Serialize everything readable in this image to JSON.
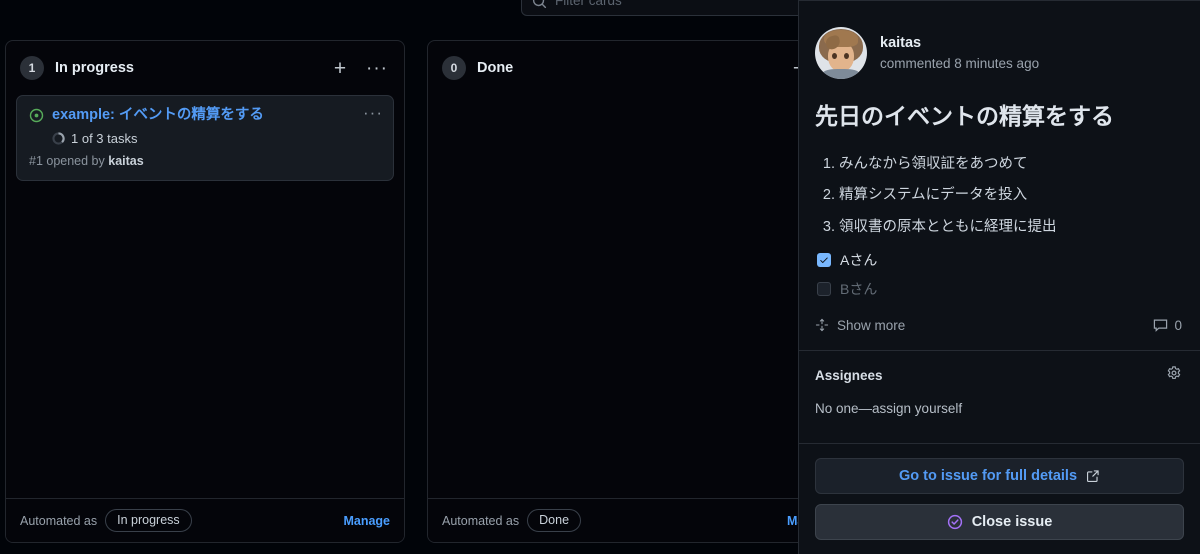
{
  "search": {
    "placeholder": "Filter cards",
    "icon": "search-icon"
  },
  "board": {
    "columns": [
      {
        "count": "1",
        "title": "In progress",
        "add_icon": "plus-icon",
        "menu_icon": "kebab-menu-icon",
        "automation_label": "Automated as",
        "automation_value": "In progress",
        "manage_label": "Manage",
        "cards": [
          {
            "status_icon": "issue-open-icon",
            "title": "example: イベントの精算をする",
            "progress_icon": "task-progress-icon",
            "tasks": "1 of 3 tasks",
            "meta_prefix": "#1 opened by",
            "meta_author": "kaitas",
            "menu_icon": "kebab-menu-icon"
          }
        ]
      },
      {
        "count": "0",
        "title": "Done",
        "add_icon": "plus-icon",
        "automation_label": "Automated as",
        "automation_value": "Done",
        "manage_label": "Man",
        "cards": []
      }
    ]
  },
  "panel": {
    "author": {
      "name": "kaitas",
      "meta": "commented 8 minutes ago",
      "avatar_icon": "user-avatar"
    },
    "issue_title": "先日のイベントの精算をする",
    "steps": [
      "みんなから領収証をあつめて",
      "精算システムにデータを投入",
      "領収書の原本とともに経理に提出"
    ],
    "tasks": [
      {
        "label": "Aさん",
        "checked": true
      },
      {
        "label": "Bさん",
        "checked": false
      }
    ],
    "show_more": {
      "label": "Show more",
      "icon": "expand-arrows-icon"
    },
    "comments": {
      "count": "0",
      "icon": "comment-icon"
    },
    "assignees": {
      "title": "Assignees",
      "value": "No one—assign yourself",
      "gear_icon": "gear-icon"
    },
    "actions": {
      "go_label": "Go to issue for full details",
      "go_icon": "external-link-icon",
      "close_label": "Close issue",
      "close_icon": "issue-closed-icon"
    }
  },
  "colors": {
    "accent_link": "#539bf5",
    "issue_open": "#57ab5a",
    "issue_closed": "#a371f7",
    "checkbox_on": "#79b8ff",
    "column_bg": "#04050a",
    "card_bg": "#161b22",
    "panel_bg": "#0d1117"
  }
}
